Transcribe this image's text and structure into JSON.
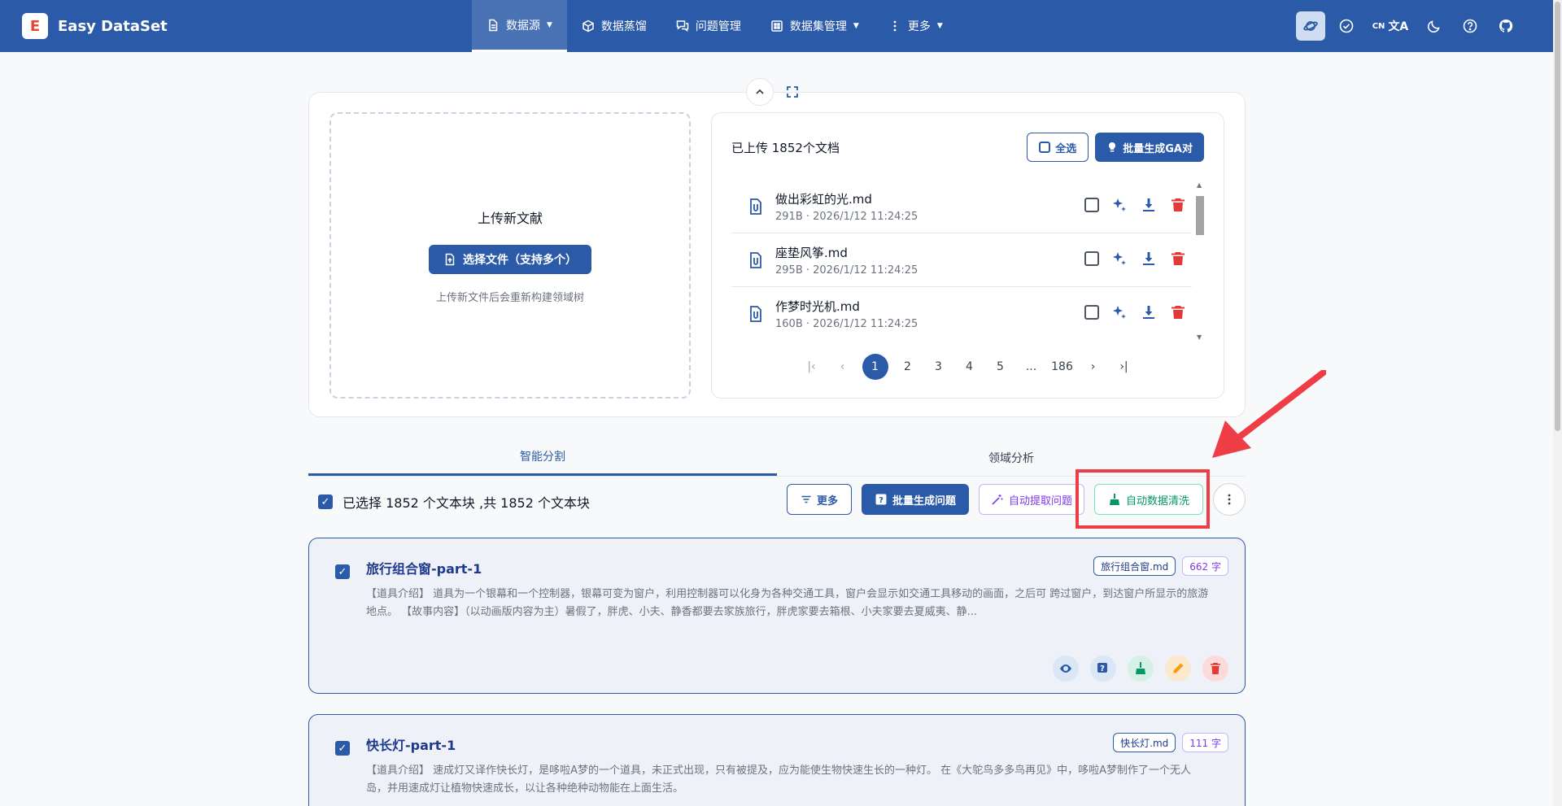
{
  "app": {
    "name": "Easy DataSet",
    "logo_letter": "E"
  },
  "nav": {
    "items": [
      {
        "label": "数据源",
        "active": true,
        "icon": "document-icon",
        "has_caret": true
      },
      {
        "label": "数据蒸馏",
        "active": false,
        "icon": "cube-icon",
        "has_caret": false
      },
      {
        "label": "问题管理",
        "active": false,
        "icon": "chat-icon",
        "has_caret": false
      },
      {
        "label": "数据集管理",
        "active": false,
        "icon": "grid-icon",
        "has_caret": true
      },
      {
        "label": "更多",
        "active": false,
        "icon": "kebab-icon",
        "has_caret": true
      }
    ]
  },
  "tools": {
    "lang_label": "CN",
    "lang_glyph": "文A"
  },
  "upload": {
    "title": "上传新文献",
    "select_button": "选择文件（支持多个）",
    "note": "上传新文件后会重新构建领域树"
  },
  "files": {
    "count_label": "已上传 1852个文档",
    "select_all": "全选",
    "batch_ga": "批量生成GA对",
    "items": [
      {
        "name": "做出彩虹的光.md",
        "meta": "291B · 2026/1/12 11:24:25"
      },
      {
        "name": "座垫风筝.md",
        "meta": "295B · 2026/1/12 11:24:25"
      },
      {
        "name": "作梦时光机.md",
        "meta": "160B · 2026/1/12 11:24:25"
      }
    ],
    "pager": {
      "pages": [
        "1",
        "2",
        "3",
        "4",
        "5",
        "...",
        "186"
      ],
      "current": "1"
    }
  },
  "tabs": [
    {
      "label": "智能分割",
      "active": true
    },
    {
      "label": "领域分析",
      "active": false
    }
  ],
  "toolbar": {
    "selection_text": "已选择 1852 个文本块 ,共 1852 个文本块",
    "more": "更多",
    "batch_questions": "批量生成问题",
    "auto_extract": "自动提取问题",
    "auto_clean": "自动数据清洗"
  },
  "chunks": [
    {
      "title": "旅行组合窗-part-1",
      "file_tag": "旅行组合窗.md",
      "count_tag": "662 字",
      "text": "【道具介绍】 道具为一个银幕和一个控制器，银幕可变为窗户，利用控制器可以化身为各种交通工具，窗户会显示如交通工具移动的画面，之后可 跨过窗户，到达窗户所显示的旅游地点。 【故事内容】（以动画版内容为主）暑假了，胖虎、小夫、静香都要去家族旅行，胖虎家要去箱根、小夫家要去夏威夷、静..."
    },
    {
      "title": "快长灯-part-1",
      "file_tag": "快长灯.md",
      "count_tag": "111 字",
      "text": "【道具介绍】 速成灯又译作快长灯，是哆啦A梦的一个道具，未正式出现，只有被提及，应为能使生物快速生长的一种灯。 在《大鸵鸟多多鸟再见》中，哆啦A梦制作了一个无人岛，并用速成灯让植物快速成长，以让各种绝种动物能在上面生活。"
    }
  ],
  "colors": {
    "brand": "#2a5aa8",
    "highlight": "#ef3d45"
  }
}
